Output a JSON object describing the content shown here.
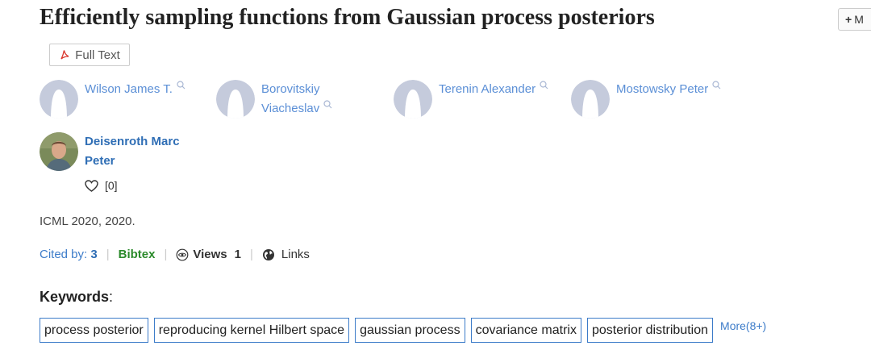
{
  "paper": {
    "title": "Efficiently sampling functions from Gaussian process posteriors",
    "more_button": "M",
    "full_text_label": "Full Text",
    "venue": "ICML 2020, 2020."
  },
  "authors": [
    {
      "name_line1": "Wilson James T.",
      "name_line2": ""
    },
    {
      "name_line1": "Borovitskiy",
      "name_line2": "Viacheslav"
    },
    {
      "name_line1": "Terenin Alexander",
      "name_line2": ""
    },
    {
      "name_line1": "Mostowsky Peter",
      "name_line2": ""
    },
    {
      "name_line1": "Deisenroth Marc",
      "name_line2": "Peter"
    }
  ],
  "like": {
    "count_label": "[0]"
  },
  "meta": {
    "cited_label": "Cited by:",
    "cited_count": "3",
    "bibtex_label": "Bibtex",
    "views_label": "Views",
    "views_count": "1",
    "links_label": "Links"
  },
  "keywords": {
    "heading": "Keywords",
    "heading_colon": ":",
    "items": [
      "process posterior",
      "reproducing kernel Hilbert space",
      "gaussian process",
      "covariance matrix",
      "posterior distribution"
    ],
    "more_label": "More(8+)"
  },
  "colors": {
    "accent": "#3d7cc9",
    "bibtex": "#2b8a2b",
    "avatar_placeholder": "#c5cbdc"
  }
}
